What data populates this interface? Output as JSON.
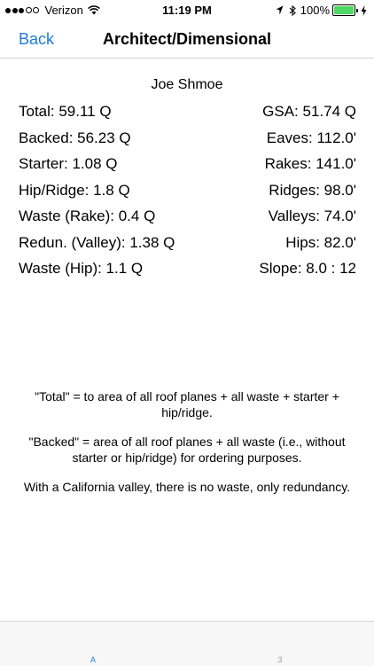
{
  "status_bar": {
    "carrier": "Verizon",
    "time": "11:19 PM",
    "battery_percent": "100%",
    "battery_level": 1.0,
    "battery_color": "#4cd964"
  },
  "nav": {
    "back_label": "Back",
    "title": "Architect/Dimensional"
  },
  "customer_name": "Joe Shmoe",
  "stats": [
    {
      "left": "Total: 59.11 Q",
      "right": "GSA: 51.74 Q"
    },
    {
      "left": "Backed: 56.23 Q",
      "right": "Eaves: 112.0'"
    },
    {
      "left": "Starter: 1.08 Q",
      "right": "Rakes: 141.0'"
    },
    {
      "left": "Hip/Ridge: 1.8 Q",
      "right": "Ridges: 98.0'"
    },
    {
      "left": "Waste (Rake): 0.4 Q",
      "right": "Valleys: 74.0'"
    },
    {
      "left": "Redun. (Valley): 1.38 Q",
      "right": "Hips: 82.0'"
    },
    {
      "left": "Waste (Hip): 1.1 Q",
      "right": "Slope: 8.0 : 12"
    }
  ],
  "notes": [
    "\"Total\" = to area of all roof planes + all waste + starter + hip/ridge.",
    "\"Backed\" = area of all roof planes + all waste (i.e., without starter or hip/ridge) for ordering purposes.",
    "With a California valley, there is no waste, only redundancy."
  ],
  "tabs": [
    {
      "label": "A",
      "active": true
    },
    {
      "label": "3",
      "active": false
    }
  ],
  "colors": {
    "accent": "#1e7ad8",
    "inactive_tab": "#999999"
  }
}
